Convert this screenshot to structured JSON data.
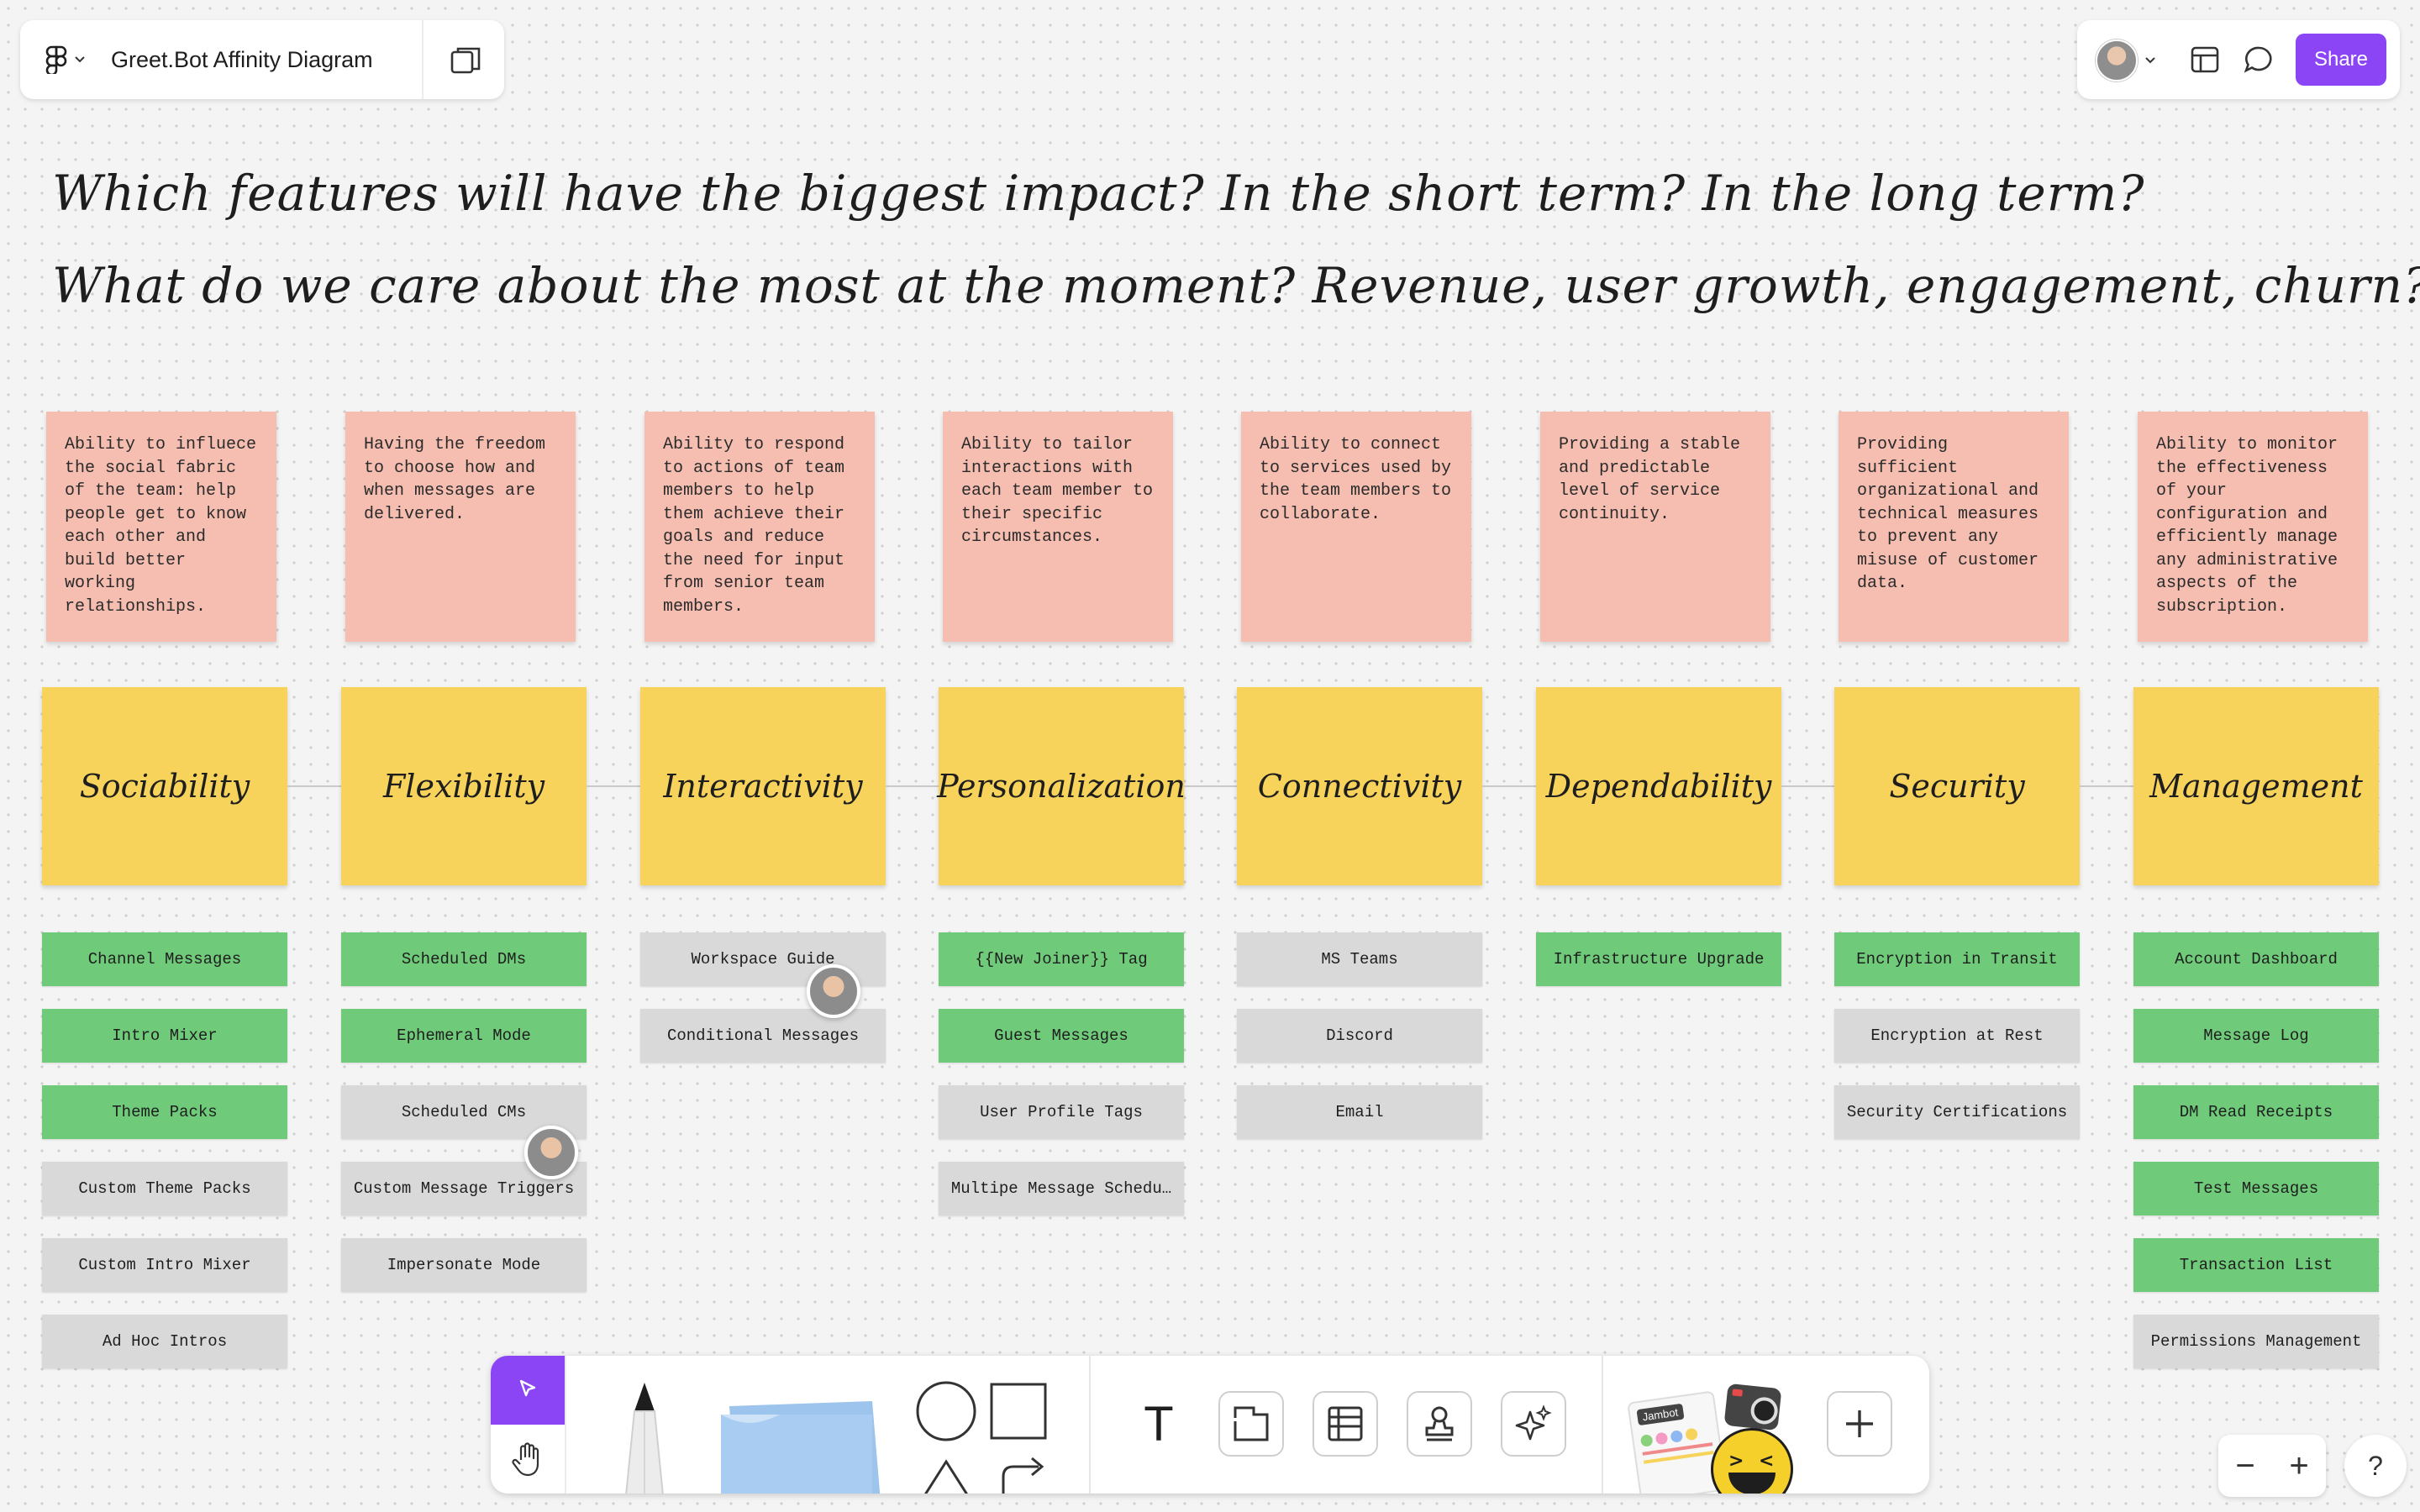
{
  "file": {
    "title": "Greet.Bot Affinity Diagram"
  },
  "share_label": "Share",
  "prompts": [
    "Which features will have the biggest impact? In the short term? In the long term?",
    "What do we care about the most at the moment? Revenue, user growth, engagement, churn?"
  ],
  "columns": [
    {
      "title": "Sociability",
      "description": "Ability to influece the social fabric of the team: help people get to know each other and build better working relationships.",
      "cards": [
        {
          "label": "Channel Messages",
          "color": "green"
        },
        {
          "label": "Intro Mixer",
          "color": "green"
        },
        {
          "label": "Theme Packs",
          "color": "green"
        },
        {
          "label": "Custom Theme Packs",
          "color": "gray"
        },
        {
          "label": "Custom Intro Mixer",
          "color": "gray"
        },
        {
          "label": "Ad Hoc Intros",
          "color": "gray"
        }
      ]
    },
    {
      "title": "Flexibility",
      "description": "Having the freedom to choose how and when messages are delivered.",
      "cards": [
        {
          "label": "Scheduled DMs",
          "color": "green"
        },
        {
          "label": "Ephemeral Mode",
          "color": "green"
        },
        {
          "label": "Scheduled CMs",
          "color": "gray"
        },
        {
          "label": "Custom Message Triggers",
          "color": "gray"
        },
        {
          "label": "Impersonate Mode",
          "color": "gray"
        }
      ]
    },
    {
      "title": "Interactivity",
      "description": "Ability to respond to actions of team members to help them achieve their goals and reduce the need for input from senior team members.",
      "cards": [
        {
          "label": "Workspace Guide",
          "color": "gray"
        },
        {
          "label": "Conditional Messages",
          "color": "gray"
        }
      ]
    },
    {
      "title": "Personalization",
      "description": "Ability to tailor interactions with each team member to their specific circumstances.",
      "cards": [
        {
          "label": "{{New Joiner}} Tag",
          "color": "green"
        },
        {
          "label": "Guest Messages",
          "color": "green"
        },
        {
          "label": "User Profile Tags",
          "color": "gray"
        },
        {
          "label": "Multipe Message Schedu…",
          "color": "gray"
        }
      ]
    },
    {
      "title": "Connectivity",
      "description": "Ability to connect to services used by the team members to collaborate.",
      "cards": [
        {
          "label": "MS Teams",
          "color": "gray"
        },
        {
          "label": "Discord",
          "color": "gray"
        },
        {
          "label": "Email",
          "color": "gray"
        }
      ]
    },
    {
      "title": "Dependability",
      "description": "Providing a stable and predictable level of service continuity.",
      "cards": [
        {
          "label": "Infrastructure Upgrade",
          "color": "green"
        }
      ]
    },
    {
      "title": "Security",
      "description": "Providing sufficient organizational and technical measures to prevent any misuse of customer data.",
      "cards": [
        {
          "label": "Encryption in Transit",
          "color": "green"
        },
        {
          "label": "Encryption at Rest",
          "color": "gray"
        },
        {
          "label": "Security Certifications",
          "color": "gray"
        }
      ]
    },
    {
      "title": "Management",
      "description": "Ability to monitor the effectiveness of your configuration and efficiently manage any administrative aspects of the subscription.",
      "cards": [
        {
          "label": "Account Dashboard",
          "color": "green"
        },
        {
          "label": "Message Log",
          "color": "green"
        },
        {
          "label": "DM Read Receipts",
          "color": "green"
        },
        {
          "label": "Test Messages",
          "color": "green"
        },
        {
          "label": "Transaction List",
          "color": "green"
        },
        {
          "label": "Permissions Management",
          "color": "gray"
        }
      ]
    }
  ],
  "toolbar": {
    "text_tool_glyph": "T",
    "widget_label": "Jambot",
    "zoom_out_glyph": "−",
    "zoom_in_glyph": "+",
    "help_glyph": "?"
  },
  "colors": {
    "accent": "#8b45f5",
    "pink": "#f5beb1",
    "yellow": "#f7d35c",
    "green": "#6fca7a",
    "gray": "#d9d9d9"
  }
}
